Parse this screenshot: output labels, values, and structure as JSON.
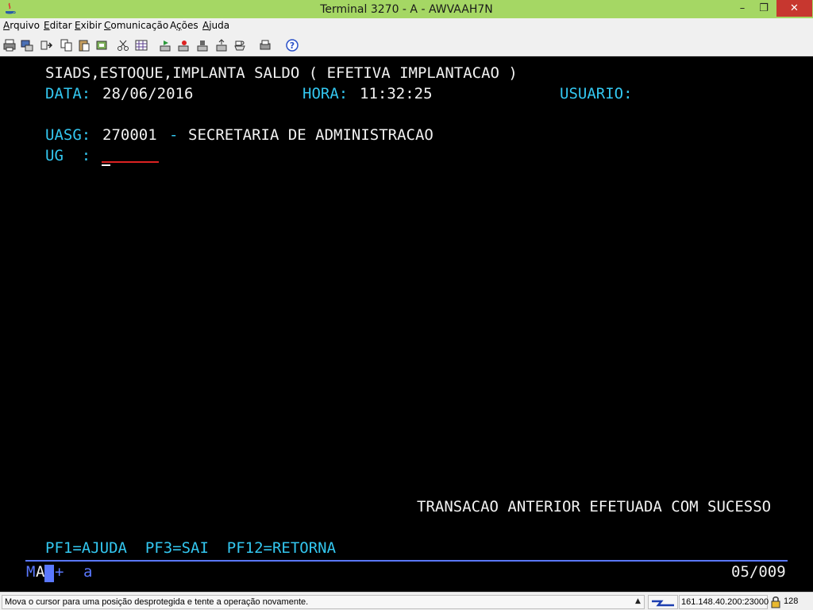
{
  "window": {
    "title": "Terminal 3270 - A - AWVAAH7N",
    "minimize": "–",
    "maximize": "❐",
    "close": "✕"
  },
  "menu": [
    {
      "prefix": "",
      "mnemonic": "A",
      "rest": "rquivo"
    },
    {
      "prefix": "",
      "mnemonic": "E",
      "rest": "ditar"
    },
    {
      "prefix": "",
      "mnemonic": "E",
      "rest": "xibir"
    },
    {
      "prefix": "",
      "mnemonic": "C",
      "rest": "omunicação"
    },
    {
      "prefix": "A",
      "mnemonic": "ç",
      "rest": "ões"
    },
    {
      "prefix": "",
      "mnemonic": "A",
      "rest": "juda"
    }
  ],
  "toolbar_icons": [
    "print-screen-icon",
    "print-icon",
    "paste-link-icon",
    "copy-icon",
    "paste-icon",
    "copy-append-icon",
    "cut-icon",
    "keypad-icon",
    "macro-play-icon",
    "macro-record-icon",
    "macro-stop-icon",
    "send-file-icon",
    "receive-file-icon",
    "printer-setup-icon",
    "help-icon"
  ],
  "screen": {
    "header": "SIADS,ESTOQUE,IMPLANTA SALDO ( EFETIVA IMPLANTACAO )",
    "date_label": "DATA:",
    "date_value": "28/06/2016",
    "time_label": "HORA:",
    "time_value": "11:32:25",
    "user_label": "USUARIO:",
    "uasg_label": "UASG:",
    "uasg_code": "270001",
    "uasg_sep": "-",
    "uasg_name": "SECRETARIA DE ADMINISTRACAO",
    "ug_label": "UG  :",
    "message": "TRANSACAO ANTERIOR EFETUADA COM SUCESSO",
    "pfkeys": "PF1=AJUDA  PF3=SAI  PF12=RETORNA"
  },
  "oia": {
    "indicator_left": "M",
    "indicator_mid": "A",
    "plus": "+",
    "mode": "a",
    "cursor_pos": "05/009"
  },
  "statusbar": {
    "message": "Mova o cursor para uma posição desprotegida e tente a operação novamente.",
    "up_arrow": "▲",
    "host": "161.148.40.200:23000",
    "encoding": "128"
  },
  "colors": {
    "titlebar": "#a5d764",
    "terminal_bg": "#000000",
    "field_cyan": "#33c7f0",
    "field_white": "#f2f2f2",
    "oia_blue": "#5a78ff",
    "input_underline": "#dd2222"
  }
}
